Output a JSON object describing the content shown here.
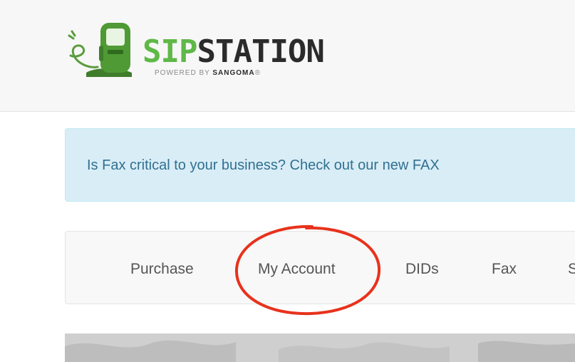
{
  "header": {
    "logo": {
      "word_primary": "SIP",
      "word_secondary": "STATION",
      "tagline_prefix": "POWERED BY",
      "tagline_brand": "SANGOMA",
      "tagline_mark": "®",
      "icon": "fuel-pump-plug-icon"
    }
  },
  "alert": {
    "text": "Is Fax critical to your business? Check out our new FAX"
  },
  "nav": {
    "items": [
      {
        "label": "Purchase"
      },
      {
        "label": "My Account"
      },
      {
        "label": "DIDs"
      },
      {
        "label": "Fax"
      },
      {
        "label": "S"
      }
    ]
  },
  "annotation": {
    "icon": "red-circle-highlight",
    "color": "#e8321c"
  },
  "colors": {
    "brand_green": "#5fb847",
    "alert_bg": "#d9edf7",
    "alert_text": "#31708f",
    "nav_text": "#555555"
  }
}
